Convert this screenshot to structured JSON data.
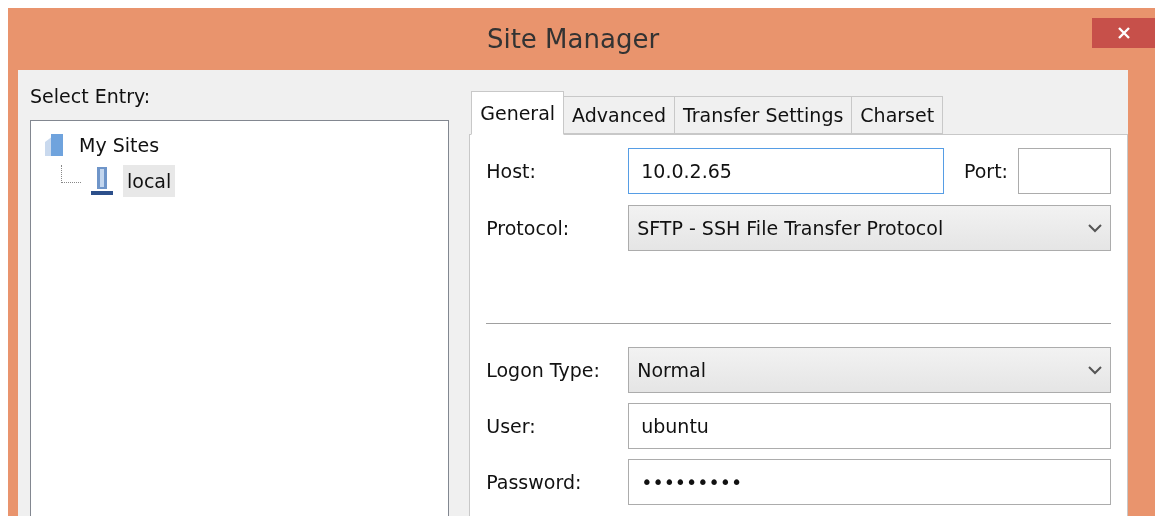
{
  "window": {
    "title": "Site Manager"
  },
  "select_entry": {
    "label": "Select Entry:",
    "tree": [
      {
        "label": "My Sites",
        "selected": false,
        "children": [
          {
            "label": "local",
            "selected": true
          }
        ]
      }
    ]
  },
  "tabs": [
    {
      "label": "General",
      "selected": true
    },
    {
      "label": "Advanced",
      "selected": false
    },
    {
      "label": "Transfer Settings",
      "selected": false
    },
    {
      "label": "Charset",
      "selected": false
    }
  ],
  "general": {
    "host": {
      "label": "Host:",
      "value": "10.0.2.65",
      "focused": true
    },
    "port": {
      "label": "Port:"
    },
    "protocol": {
      "label": "Protocol:",
      "value": "SFTP - SSH File Transfer Protocol"
    },
    "logon_type": {
      "label": "Logon Type:",
      "value": "Normal"
    },
    "user": {
      "label": "User:",
      "value": "ubuntu"
    },
    "password": {
      "label": "Password:",
      "value": "•••••••••"
    }
  }
}
